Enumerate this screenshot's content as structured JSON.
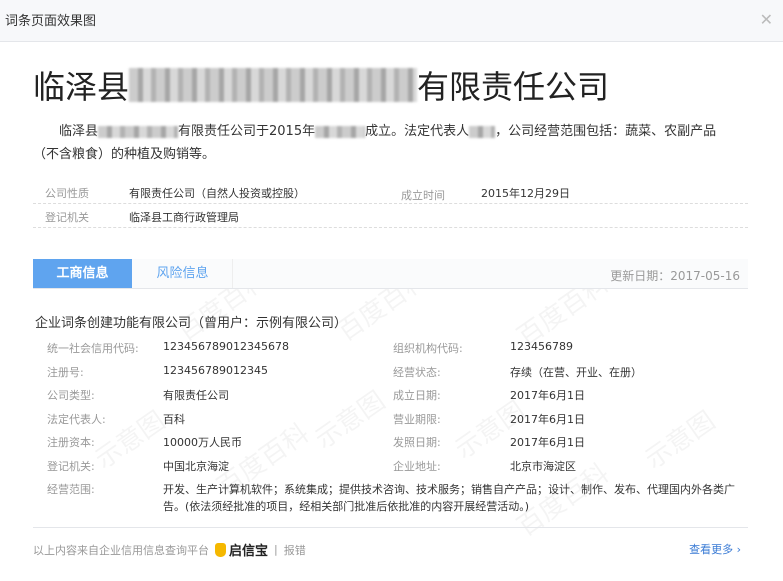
{
  "window": {
    "title": "词条页面效果图",
    "close": "✕"
  },
  "heading": {
    "prefix": "临泽县",
    "suffix": "有限责任公司"
  },
  "summary": {
    "p1": "临泽县",
    "p2": "有限责任公司于2015年",
    "p3": "成立。法定代表人",
    "p4": "，公司经营范围包括：蔬菜、农副产品（不含粮食）的种植及购销等。"
  },
  "basic": [
    {
      "label": "公司性质",
      "value": "有限责任公司（自然人投资或控股）",
      "label2": "成立时间",
      "value2": "2015年12月29日"
    },
    {
      "label": "登记机关",
      "value": "临泽县工商行政管理局"
    }
  ],
  "tabs": {
    "active": "工商信息",
    "other": "风险信息",
    "updated": "更新日期：2017-05-16"
  },
  "company": "企业词条创建功能有限公司（曾用户：示例有限公司）",
  "details": [
    {
      "l": "统一社会信用代码:",
      "v": "123456789012345678",
      "l2": "组织机构代码:",
      "v2": "123456789"
    },
    {
      "l": "注册号:",
      "v": "123456789012345",
      "l2": "经营状态:",
      "v2": "存续（在营、开业、在册）"
    },
    {
      "l": "公司类型:",
      "v": "有限责任公司",
      "l2": "成立日期:",
      "v2": "2017年6月1日"
    },
    {
      "l": "法定代表人:",
      "v": "百科",
      "l2": "营业期限:",
      "v2": "2017年6月1日"
    },
    {
      "l": "注册资本:",
      "v": "10000万人民币",
      "l2": "发照日期:",
      "v2": "2017年6月1日"
    },
    {
      "l": "登记机关:",
      "v": "中国北京海淀",
      "l2": "企业地址:",
      "v2": "北京市海淀区"
    }
  ],
  "scope": {
    "label": "经营范围:",
    "value": "开发、生产计算机软件；系统集成；提供技术咨询、技术服务；销售自产产品；设计、制作、发布、代理国内外各类广告。(依法须经批准的项目，经相关部门批准后依批准的内容开展经营活动。)"
  },
  "footer": {
    "source": "以上内容来自企业信用信息查询平台",
    "brand": "启信宝",
    "sep": "|",
    "report": "报错",
    "more": "查看更多 ›"
  },
  "watermarks": {
    "a": "百度百科",
    "b": "示意图"
  }
}
